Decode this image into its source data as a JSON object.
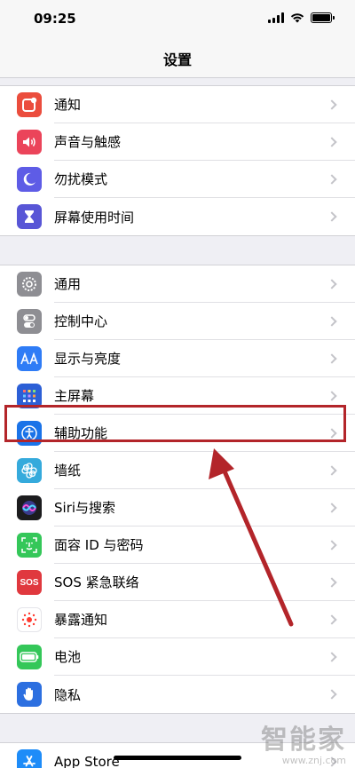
{
  "status_bar": {
    "time": "09:25"
  },
  "nav": {
    "title": "设置"
  },
  "groups": [
    {
      "items": [
        {
          "label": "通知",
          "icon": "notifications-icon",
          "color": "#eb4d3d"
        },
        {
          "label": "声音与触感",
          "icon": "sounds-icon",
          "color": "#eb445a"
        },
        {
          "label": "勿扰模式",
          "icon": "moon-icon",
          "color": "#5e5ce6"
        },
        {
          "label": "屏幕使用时间",
          "icon": "hourglass-icon",
          "color": "#5856d6"
        }
      ]
    },
    {
      "items": [
        {
          "label": "通用",
          "icon": "gear-icon",
          "color": "#8e8e93"
        },
        {
          "label": "控制中心",
          "icon": "toggles-icon",
          "color": "#8e8e93"
        },
        {
          "label": "显示与亮度",
          "icon": "text-size-icon",
          "color": "#2f7cf6"
        },
        {
          "label": "主屏幕",
          "icon": "home-screen-icon",
          "color": "#2c5fd6"
        },
        {
          "label": "辅助功能",
          "icon": "accessibility-icon",
          "color": "#1a73e8"
        },
        {
          "label": "墙纸",
          "icon": "wallpaper-icon",
          "color": "#35aadc"
        },
        {
          "label": "Siri与搜索",
          "icon": "siri-icon",
          "color": "#1c1c1e"
        },
        {
          "label": "面容 ID 与密码",
          "icon": "face-id-icon",
          "color": "#34c759"
        },
        {
          "label": "SOS 紧急联络",
          "icon": "sos-icon",
          "color": "#e0383e"
        },
        {
          "label": "暴露通知",
          "icon": "exposure-icon",
          "color": "#ffffff"
        },
        {
          "label": "电池",
          "icon": "battery-icon",
          "color": "#34c759"
        },
        {
          "label": "隐私",
          "icon": "hand-icon",
          "color": "#2c6fe0"
        }
      ]
    },
    {
      "items": [
        {
          "label": "App Store",
          "icon": "app-store-icon",
          "color": "#1e8cf8"
        }
      ]
    }
  ],
  "sos_text": "SOS",
  "watermark": {
    "text": "智能家",
    "url": "www.znj.com"
  },
  "colors": {
    "highlight": "#b3252a"
  }
}
